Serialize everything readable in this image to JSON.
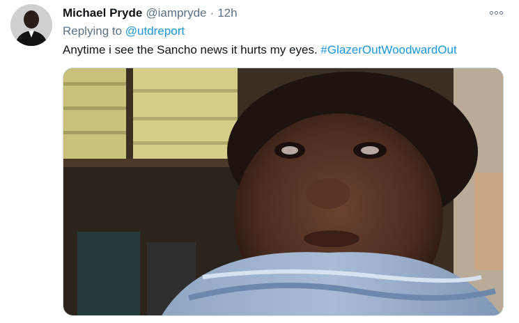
{
  "tweet": {
    "author_name": "Michael Pryde",
    "handle": "@iampryde",
    "separator": "·",
    "time": "12h",
    "replying_prefix": "Replying to",
    "replying_to": "@utdreport",
    "text": "Anytime i see the Sancho news it hurts my eyes.",
    "hashtag": "#GlazerOutWoodwardOut",
    "more_icon": "more-options-icon",
    "media_description": "photo"
  },
  "colors": {
    "link": "#1b95e0",
    "secondary_text": "#5b7083",
    "primary_text": "#0f1419"
  }
}
